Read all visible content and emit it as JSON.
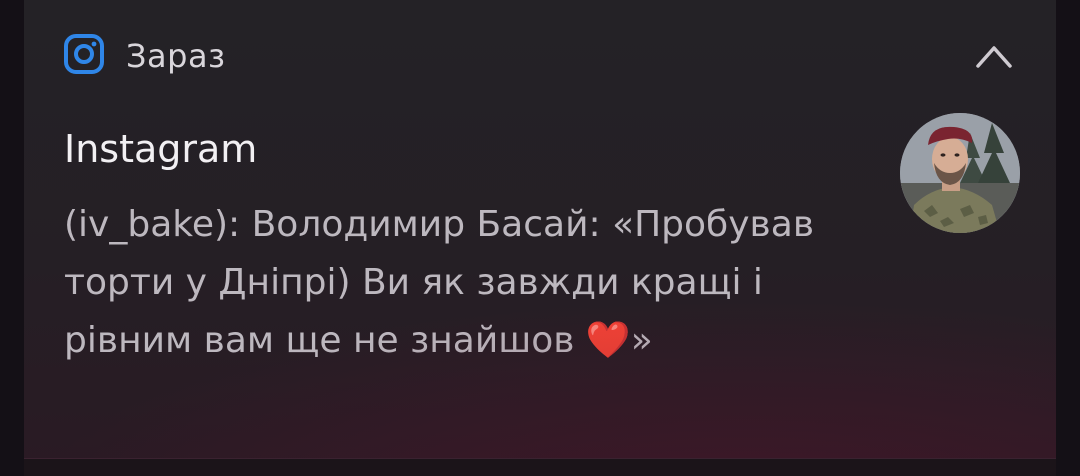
{
  "notification": {
    "app_icon": "instagram-icon",
    "time": "Зараз",
    "title": "Instagram",
    "message_parts": {
      "text": "(iv_bake): Володимир Басай: «Пробував торти у Дніпрі) Ви як завжди кращі і рівним вам ще не знайшов ",
      "heart": "❤️",
      "end": "»"
    },
    "collapse_icon": "chevron-up-icon",
    "avatar_icon": "avatar"
  },
  "colors": {
    "background": "#141016",
    "card": "#242226",
    "accent_icon": "#2f86e8",
    "heart": "#c41a24"
  }
}
